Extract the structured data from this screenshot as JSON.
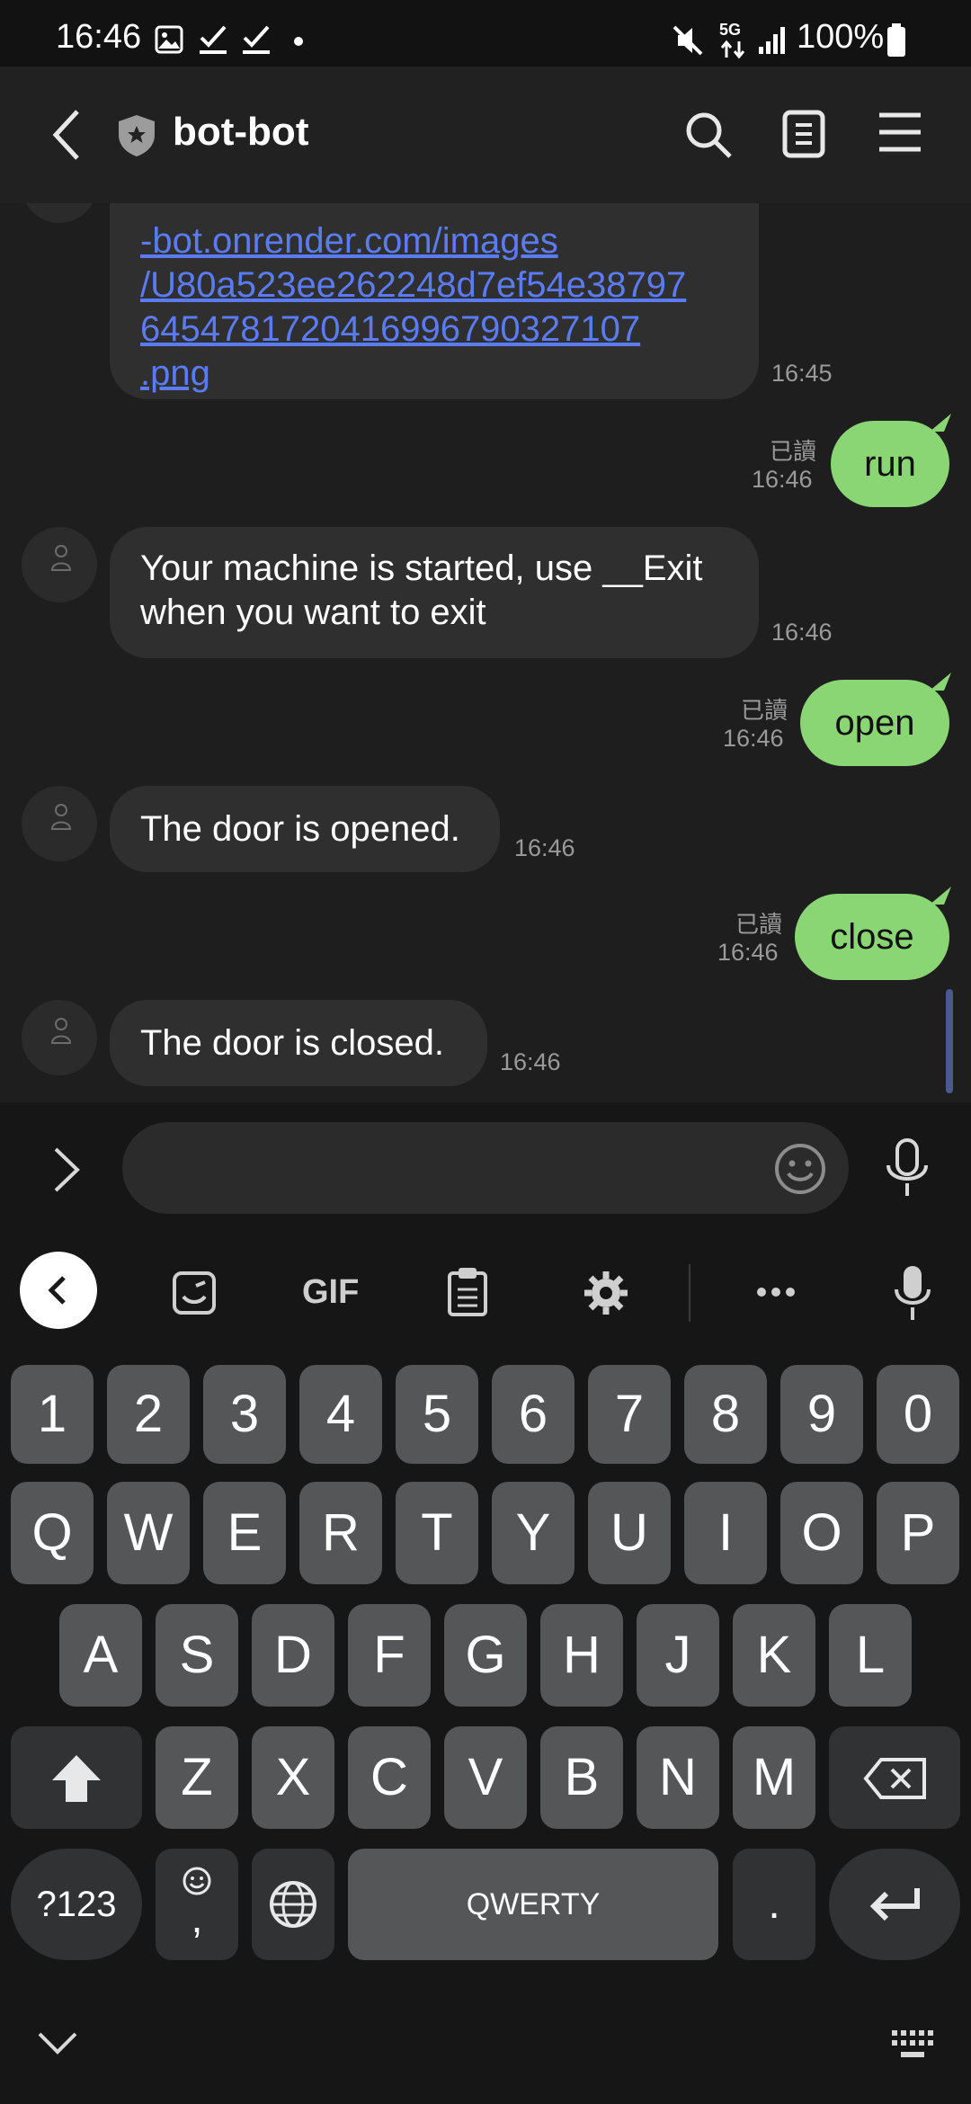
{
  "status_bar": {
    "time": "16:46",
    "network": "5G",
    "battery": "100%"
  },
  "header": {
    "back_label": "back",
    "title": "bot-bot"
  },
  "messages": {
    "link_lines": [
      "-bot.onrender.com/images",
      "/U80a523ee262248d7ef54e38797",
      "6454781720416996790327107",
      ".png"
    ],
    "link_time": "16:45",
    "run": {
      "text": "run",
      "read": "已讀",
      "time": "16:46"
    },
    "started": {
      "line1": "Your machine is started, use __Exit",
      "line2": "when you want to exit",
      "time": "16:46"
    },
    "open": {
      "text": "open",
      "read": "已讀",
      "time": "16:46"
    },
    "opened": {
      "text": "The door is opened.",
      "time": "16:46"
    },
    "close": {
      "text": "close",
      "read": "已讀",
      "time": "16:46"
    },
    "closed": {
      "text": "The door is closed.",
      "time": "16:46"
    }
  },
  "input": {
    "placeholder": ""
  },
  "keyboard": {
    "toolbar": {
      "gif": "GIF"
    },
    "row_numbers": [
      "1",
      "2",
      "3",
      "4",
      "5",
      "6",
      "7",
      "8",
      "9",
      "0"
    ],
    "row_q": [
      "Q",
      "W",
      "E",
      "R",
      "T",
      "Y",
      "U",
      "I",
      "O",
      "P"
    ],
    "row_a": [
      "A",
      "S",
      "D",
      "F",
      "G",
      "H",
      "J",
      "K",
      "L"
    ],
    "row_z": [
      "Z",
      "X",
      "C",
      "V",
      "B",
      "N",
      "M"
    ],
    "sym_key": "?123",
    "comma_key": ",",
    "space_key": "QWERTY",
    "period_key": "."
  }
}
